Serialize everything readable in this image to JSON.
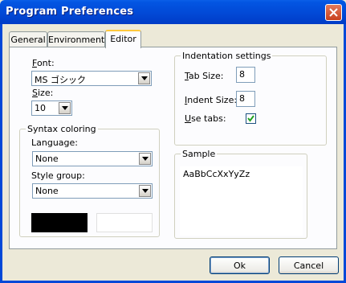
{
  "window": {
    "title": "Program Preferences"
  },
  "tabs": [
    {
      "label": "General",
      "active": false
    },
    {
      "label": "Environment",
      "active": false
    },
    {
      "label": "Editor",
      "active": true
    }
  ],
  "editor": {
    "font": {
      "label": "Font:",
      "value": "MS ゴシック"
    },
    "size": {
      "label": "Size:",
      "value": "10"
    },
    "syntax": {
      "title": "Syntax coloring",
      "language": {
        "label": "Language:",
        "value": "None"
      },
      "style_group": {
        "label": "Style group:",
        "value": "None"
      },
      "colors": {
        "foreground": "#000000",
        "background": "#ffffff"
      }
    },
    "indentation": {
      "title": "Indentation settings",
      "tab_size": {
        "label": "Tab Size:",
        "value": "8"
      },
      "indent_size": {
        "label": "Indent Size:",
        "value": "8"
      },
      "use_tabs": {
        "label": "Use tabs:",
        "checked": true
      }
    },
    "sample": {
      "title": "Sample",
      "text": "AaBbCcXxYyZz"
    }
  },
  "buttons": {
    "ok": "Ok",
    "cancel": "Cancel"
  },
  "icons": {
    "close": "close-icon",
    "dropdown": "chevron-down-icon",
    "check": "checkmark-icon"
  }
}
